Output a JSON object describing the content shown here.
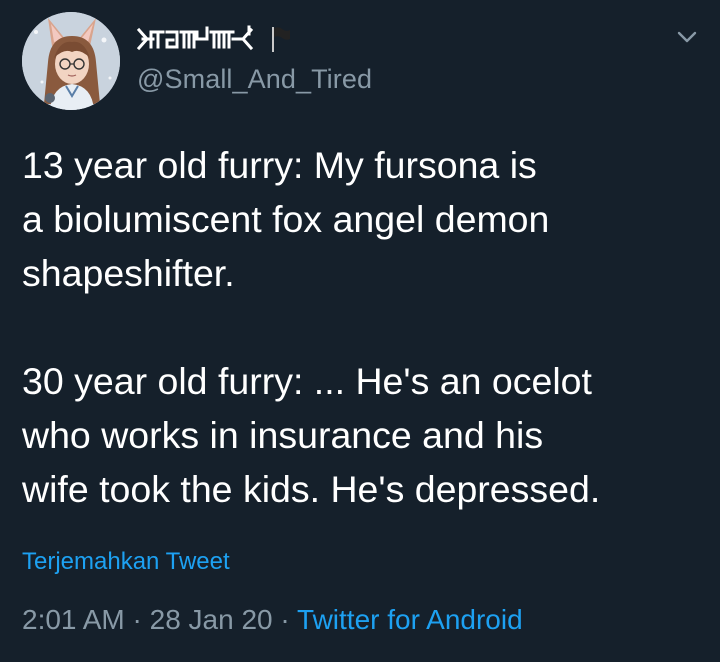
{
  "tweet": {
    "author": {
      "display_name": "⤙⧋⧢⊢╠╤╦ ⤙⟨",
      "display_name_emoji": "black-flag",
      "handle": "@Small_And_Tired",
      "avatar": "anime-fox-girl-avatar"
    },
    "menu_icon": "chevron-down-icon",
    "text": "13 year old furry: My fursona is\na biolumiscent fox angel demon\nshapeshifter.\n\n30 year old furry: ... He's an ocelot\nwho works in insurance and his\nwife took the kids. He's depressed.",
    "translate_label": "Terjemahkan Tweet",
    "time": "2:01 AM",
    "separator": " · ",
    "date": "28 Jan 20",
    "source": "Twitter for Android"
  },
  "colors": {
    "background": "#15202b",
    "text": "#ffffff",
    "secondary": "#8899a6",
    "accent": "#1da1f2"
  }
}
